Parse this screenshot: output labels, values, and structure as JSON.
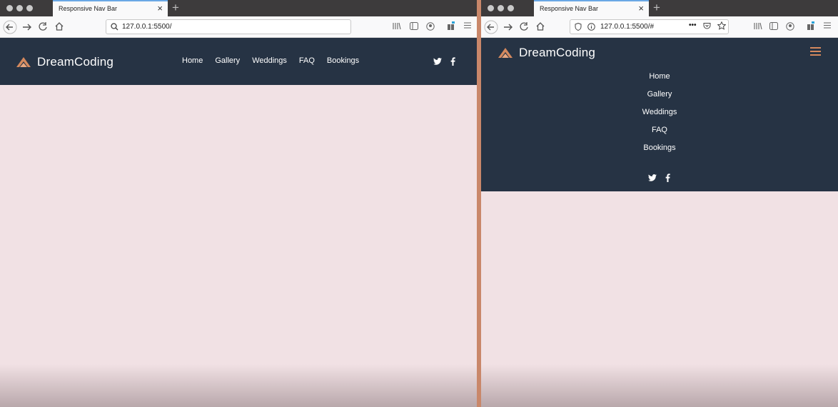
{
  "left_window": {
    "tab_title": "Responsive Nav Bar",
    "url": "127.0.0.1:5500/",
    "site": {
      "brand": "DreamCoding",
      "menu": [
        "Home",
        "Gallery",
        "Weddings",
        "FAQ",
        "Bookings"
      ]
    }
  },
  "right_window": {
    "tab_title": "Responsive Nav Bar",
    "url": "127.0.0.1:5500/#",
    "url_more": "•••",
    "site": {
      "brand": "DreamCoding",
      "menu": [
        "Home",
        "Gallery",
        "Weddings",
        "FAQ",
        "Bookings"
      ]
    }
  },
  "colors": {
    "navbar": "#263344",
    "accent": "#d4895e",
    "page_bg": "#f1e1e4"
  },
  "icons": [
    "logo-icon",
    "twitter-icon",
    "facebook-icon",
    "hamburger-icon",
    "search-icon",
    "back-icon",
    "forward-icon",
    "reload-icon",
    "home-icon"
  ]
}
